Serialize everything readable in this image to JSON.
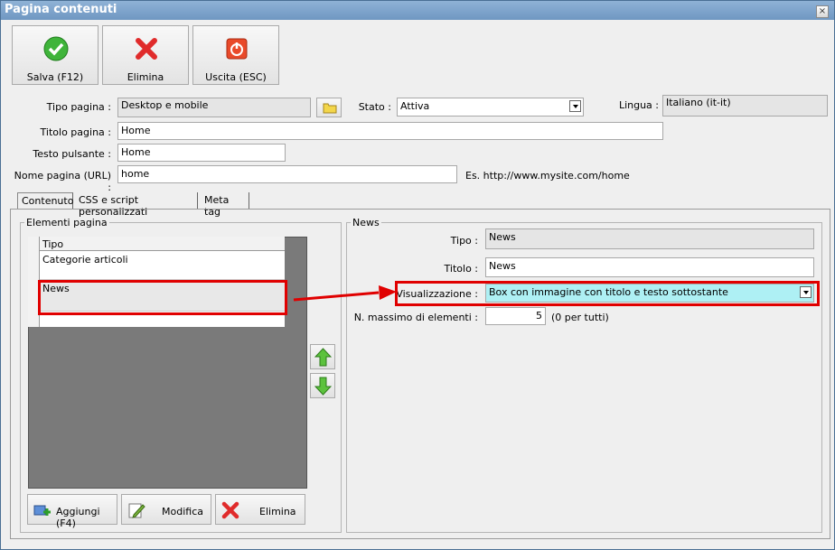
{
  "window": {
    "title": "Pagina contenuti",
    "close": "×"
  },
  "toolbar": {
    "save_label": "Salva (F12)",
    "delete_label": "Elimina",
    "exit_label": "Uscita (ESC)"
  },
  "form": {
    "tipo_pagina_label": "Tipo pagina :",
    "tipo_pagina_value": "Desktop e mobile",
    "stato_label": "Stato :",
    "stato_value": "Attiva",
    "lingua_label": "Lingua :",
    "lingua_value": "Italiano (it-it)",
    "titolo_label": "Titolo pagina :",
    "titolo_value": "Home",
    "testo_pulsante_label": "Testo pulsante :",
    "testo_pulsante_value": "Home",
    "nome_pagina_label": "Nome pagina (URL) :",
    "nome_pagina_value": "home",
    "url_example": "Es. http://www.mysite.com/home"
  },
  "tabs": [
    "Contenuto",
    "CSS e script personalizzati",
    "Meta tag"
  ],
  "elements_panel": {
    "title": "Elementi pagina",
    "column_header": "Tipo",
    "rows": [
      "Categorie articoli",
      "News"
    ],
    "add_label": "Aggiungi (F4)",
    "edit_label": "Modifica",
    "delete_label": "Elimina"
  },
  "news_panel": {
    "title": "News",
    "tipo_label": "Tipo :",
    "tipo_value": "News",
    "titolo_label": "Titolo :",
    "titolo_value": "News",
    "visualizzazione_label": "Visualizzazione :",
    "visualizzazione_value": "Box con immagine con titolo e testo sottostante",
    "max_label": "N. massimo di elementi :",
    "max_value": "5",
    "max_hint": "(0 per tutti)"
  },
  "colors": {
    "highlight": "#e00000",
    "selected_combo": "#aef0f4",
    "accent_blue": "#6f97c2"
  }
}
